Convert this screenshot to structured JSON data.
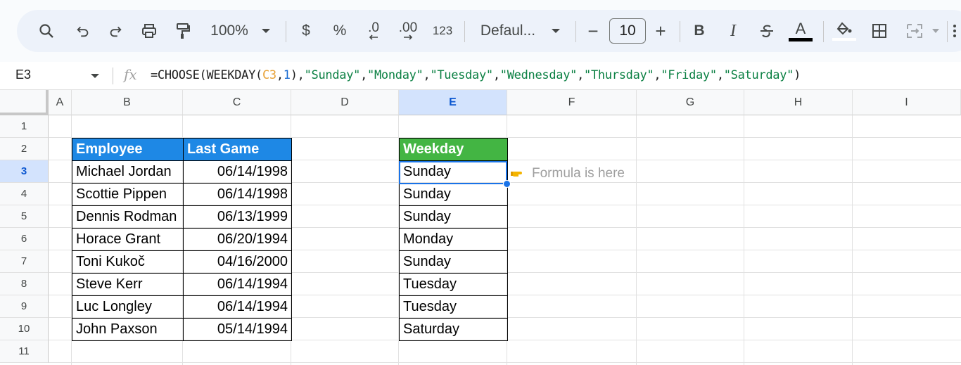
{
  "toolbar": {
    "zoom": "100%",
    "currency": "$",
    "percent": "%",
    "decrease_decimal": ".0",
    "increase_decimal": ".00",
    "number_format": "123",
    "font": "Defaul...",
    "font_size_minus": "−",
    "font_size": "10",
    "font_size_plus": "+",
    "bold": "B",
    "italic": "I",
    "text_color_letter": "A",
    "icons": [
      "search-icon",
      "undo-icon",
      "redo-icon",
      "print-icon",
      "paint-format-icon",
      "chevron-down-icon",
      "strikethrough-icon",
      "fill-color-icon",
      "borders-icon",
      "merge-cells-icon",
      "more-icon"
    ]
  },
  "formula_bar": {
    "name_box": "E3",
    "fx": "fx",
    "formula_parts": [
      {
        "text": "=CHOOSE(WEEKDAY(",
        "kind": "plain"
      },
      {
        "text": "C3",
        "kind": "ref"
      },
      {
        "text": ",",
        "kind": "plain"
      },
      {
        "text": "1",
        "kind": "num"
      },
      {
        "text": "),",
        "kind": "plain"
      },
      {
        "text": "\"Sunday\"",
        "kind": "str"
      },
      {
        "text": ",",
        "kind": "plain"
      },
      {
        "text": "\"Monday\"",
        "kind": "str"
      },
      {
        "text": ",",
        "kind": "plain"
      },
      {
        "text": "\"Tuesday\"",
        "kind": "str"
      },
      {
        "text": ",",
        "kind": "plain"
      },
      {
        "text": "\"Wednesday\"",
        "kind": "str"
      },
      {
        "text": ",",
        "kind": "plain"
      },
      {
        "text": "\"Thursday\"",
        "kind": "str"
      },
      {
        "text": ",",
        "kind": "plain"
      },
      {
        "text": "\"Friday\"",
        "kind": "str"
      },
      {
        "text": ",",
        "kind": "plain"
      },
      {
        "text": "\"Saturday\"",
        "kind": "str"
      },
      {
        "text": ")",
        "kind": "plain"
      }
    ]
  },
  "columns": [
    "A",
    "B",
    "C",
    "D",
    "E",
    "F",
    "G",
    "H",
    "I"
  ],
  "rows": [
    "1",
    "2",
    "3",
    "4",
    "5",
    "6",
    "7",
    "8",
    "9",
    "10",
    "11"
  ],
  "selected_column": "E",
  "selected_row": "3",
  "table": {
    "headers": [
      "Employee",
      "Last Game"
    ],
    "rows": [
      [
        "Michael Jordan",
        "06/14/1998"
      ],
      [
        "Scottie Pippen",
        "06/14/1998"
      ],
      [
        "Dennis Rodman",
        "06/13/1999"
      ],
      [
        "Horace Grant",
        "06/20/1994"
      ],
      [
        "Toni Kukoč",
        "04/16/2000"
      ],
      [
        "Steve Kerr",
        "06/14/1994"
      ],
      [
        "Luc Longley",
        "06/14/1994"
      ],
      [
        "John Paxson",
        "05/14/1994"
      ]
    ]
  },
  "weekday": {
    "header": "Weekday",
    "values": [
      "Sunday",
      "Sunday",
      "Sunday",
      "Monday",
      "Sunday",
      "Tuesday",
      "Tuesday",
      "Saturday"
    ]
  },
  "note": {
    "text": "Formula is here",
    "icon": "pointing-hand-icon"
  },
  "colors": {
    "employee_header": "#1e88e5",
    "weekday_header": "#43b543",
    "selection": "#1a73e8"
  }
}
